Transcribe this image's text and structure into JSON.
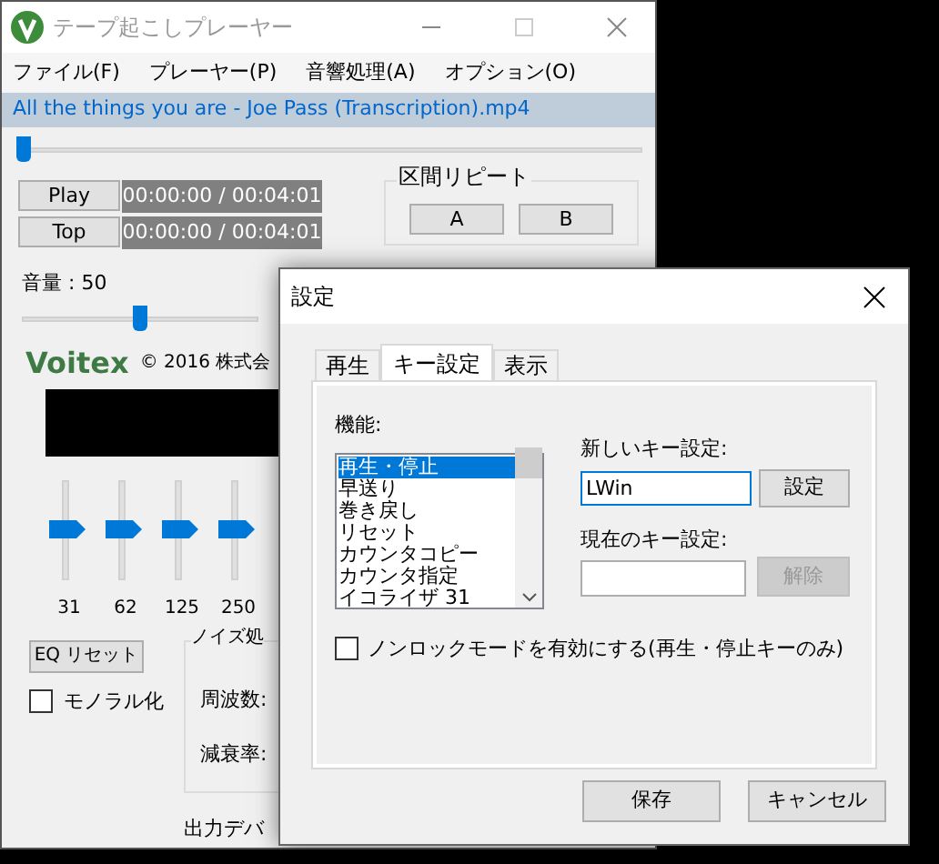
{
  "window": {
    "title": "テープ起こしプレーヤー"
  },
  "menu": [
    "ファイル(F)",
    "プレーヤー(P)",
    "音響処理(A)",
    "オプション(O)"
  ],
  "file_name": "All the things you are - Joe Pass (Transcription).mp4",
  "position": {
    "level": 0.0
  },
  "transport": [
    {
      "label": "Play",
      "time": "00:00:00 / 00:04:01"
    },
    {
      "label": "Top",
      "time": "00:00:00 / 00:04:01"
    }
  ],
  "repeat": {
    "title": "区間リピート",
    "buttons": [
      "A",
      "B"
    ]
  },
  "volume": {
    "label": "音量 : 50",
    "level": 0.5
  },
  "logo": "Voitex",
  "copyright": "© 2016 株式会",
  "eq": {
    "bands": [
      {
        "label": "31",
        "level": 0.5
      },
      {
        "label": "62",
        "level": 0.5
      },
      {
        "label": "125",
        "level": 0.5
      },
      {
        "label": "250",
        "level": 0.5
      }
    ],
    "reset": "EQ リセット"
  },
  "mono": {
    "label": "モノラル化",
    "checked": false
  },
  "noise": {
    "title": "ノイズ処",
    "frequency_label": "周波数:",
    "attenuation_label": "減衰率:"
  },
  "output_device_label": "出力デバ",
  "dialog": {
    "title": "設定",
    "tabs": [
      {
        "label": "再生",
        "selected": false
      },
      {
        "label": "キー設定",
        "selected": true
      },
      {
        "label": "表示",
        "selected": false
      }
    ],
    "function_label": "機能:",
    "functions": [
      {
        "label": "再生・停止",
        "selected": true
      },
      {
        "label": "早送り",
        "selected": false
      },
      {
        "label": "巻き戻し",
        "selected": false
      },
      {
        "label": "リセット",
        "selected": false
      },
      {
        "label": "カウンタコピー",
        "selected": false
      },
      {
        "label": "カウンタ指定",
        "selected": false
      },
      {
        "label": "イコライザ 31",
        "selected": false
      }
    ],
    "new_key_label": "新しいキー設定:",
    "new_key_value": "LWin",
    "set_button": "設定",
    "current_key_label": "現在のキー設定:",
    "clear_button": {
      "label": "解除",
      "disabled": true
    },
    "nonlock": {
      "label": "ノンロックモードを有効にする(再生・停止キーのみ)",
      "checked": false
    },
    "buttons": [
      "保存",
      "キャンセル"
    ]
  }
}
